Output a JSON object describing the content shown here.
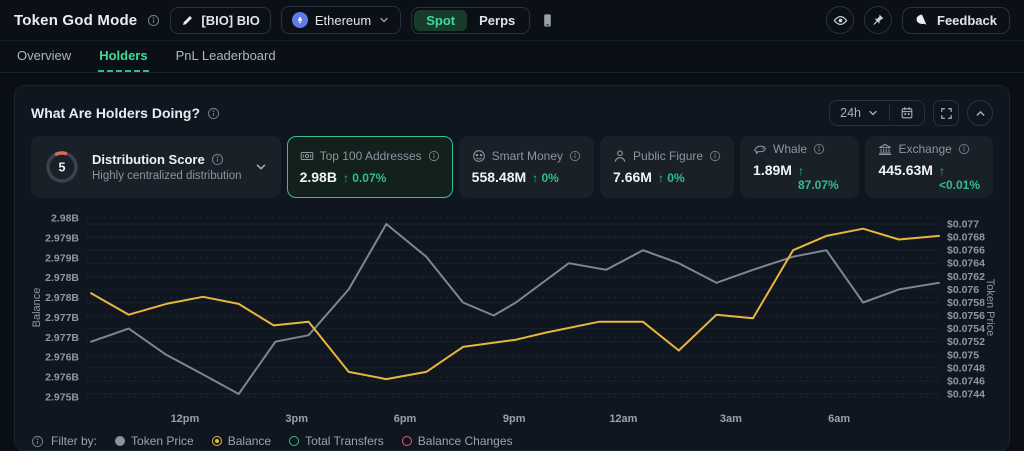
{
  "header": {
    "title": "Token God Mode",
    "token_button": "[BIO] BIO",
    "network": "Ethereum",
    "market_tabs": {
      "spot": "Spot",
      "perps": "Perps"
    },
    "feedback_label": "Feedback"
  },
  "tabs": [
    {
      "label": "Overview",
      "active": false
    },
    {
      "label": "Holders",
      "active": true
    },
    {
      "label": "PnL Leaderboard",
      "active": false
    }
  ],
  "panel": {
    "title": "What Are Holders Doing?",
    "timeframe": "24h",
    "stats": [
      {
        "kind": "gauge",
        "label": "Distribution Score",
        "score": "5",
        "subtitle": "Highly centralized distribution"
      },
      {
        "kind": "metric",
        "icon": "banknote",
        "label": "Top 100 Addresses",
        "value": "2.98B",
        "change": "0.07%",
        "selected": true
      },
      {
        "kind": "metric",
        "icon": "smart-money",
        "label": "Smart Money",
        "value": "558.48M",
        "change": "0%",
        "selected": false
      },
      {
        "kind": "metric",
        "icon": "person",
        "label": "Public Figure",
        "value": "7.66M",
        "change": "0%",
        "selected": false
      },
      {
        "kind": "metric",
        "icon": "whale",
        "label": "Whale",
        "value": "1.89M",
        "change": "87.07%",
        "selected": false
      },
      {
        "kind": "metric",
        "icon": "bank",
        "label": "Exchange",
        "value": "445.63M",
        "change": "<0.01%",
        "selected": false
      }
    ],
    "filter": {
      "label": "Filter by:",
      "options": [
        {
          "label": "Token Price",
          "style": "filled",
          "color": "#8a93a0"
        },
        {
          "label": "Balance",
          "style": "selected",
          "color": "#e9b53f"
        },
        {
          "label": "Total Transfers",
          "style": "ring",
          "color": "#2fbe8a"
        },
        {
          "label": "Balance Changes",
          "style": "ring",
          "color": "#e05c6e"
        }
      ]
    }
  },
  "chart_data": {
    "type": "line",
    "title": "What Are Holders Doing?",
    "grid": true,
    "x_axis": {
      "ticks": [
        {
          "pos": 0.116,
          "label": "12pm"
        },
        {
          "pos": 0.247,
          "label": "3pm"
        },
        {
          "pos": 0.374,
          "label": "6pm"
        },
        {
          "pos": 0.502,
          "label": "9pm"
        },
        {
          "pos": 0.63,
          "label": "12am"
        },
        {
          "pos": 0.756,
          "label": "3am"
        },
        {
          "pos": 0.883,
          "label": "6am"
        }
      ]
    },
    "left_axis": {
      "title": "Balance",
      "max": 2.98,
      "min": 2.975,
      "labels": [
        "2.98B",
        "2.979B",
        "2.979B",
        "2.978B",
        "2.978B",
        "2.977B",
        "2.977B",
        "2.976B",
        "2.976B",
        "2.975B"
      ]
    },
    "right_axis": {
      "title": "Token Price",
      "max": 0.077,
      "min": 0.0744,
      "labels": [
        "$0.077",
        "$0.0768",
        "$0.0766",
        "$0.0764",
        "$0.0762",
        "$0.076",
        "$0.0758",
        "$0.0756",
        "$0.0754",
        "$0.0752",
        "$0.075",
        "$0.0748",
        "$0.0746",
        "$0.0744"
      ]
    },
    "series": [
      {
        "name": "Token Price",
        "axis": "right",
        "color": "#7d8691",
        "points": [
          [
            0.006,
            0.0752
          ],
          [
            0.05,
            0.0754
          ],
          [
            0.094,
            0.075
          ],
          [
            0.137,
            0.0747
          ],
          [
            0.179,
            0.0744
          ],
          [
            0.222,
            0.0752
          ],
          [
            0.261,
            0.0753
          ],
          [
            0.308,
            0.076
          ],
          [
            0.352,
            0.077
          ],
          [
            0.399,
            0.0765
          ],
          [
            0.442,
            0.0758
          ],
          [
            0.478,
            0.0756
          ],
          [
            0.504,
            0.0758
          ],
          [
            0.566,
            0.0764
          ],
          [
            0.61,
            0.0763
          ],
          [
            0.653,
            0.0766
          ],
          [
            0.695,
            0.0764
          ],
          [
            0.739,
            0.0761
          ],
          [
            0.782,
            0.0763
          ],
          [
            0.829,
            0.0765
          ],
          [
            0.868,
            0.0766
          ],
          [
            0.911,
            0.0758
          ],
          [
            0.953,
            0.076
          ],
          [
            1.0,
            0.0761
          ]
        ]
      },
      {
        "name": "Balance",
        "axis": "left",
        "color": "#e9b53f",
        "points": [
          [
            0.006,
            2.9779
          ],
          [
            0.05,
            2.9773
          ],
          [
            0.094,
            2.9776
          ],
          [
            0.137,
            2.9778
          ],
          [
            0.179,
            2.9776
          ],
          [
            0.22,
            2.977
          ],
          [
            0.261,
            2.9771
          ],
          [
            0.308,
            2.9757
          ],
          [
            0.352,
            2.9755
          ],
          [
            0.399,
            2.9757
          ],
          [
            0.442,
            2.9764
          ],
          [
            0.504,
            2.9766
          ],
          [
            0.539,
            2.9768
          ],
          [
            0.601,
            2.9771
          ],
          [
            0.653,
            2.9771
          ],
          [
            0.695,
            2.9763
          ],
          [
            0.739,
            2.9773
          ],
          [
            0.782,
            2.9772
          ],
          [
            0.829,
            2.9791
          ],
          [
            0.868,
            2.9795
          ],
          [
            0.911,
            2.9797
          ],
          [
            0.953,
            2.9794
          ],
          [
            1.0,
            2.9795
          ]
        ]
      }
    ]
  }
}
